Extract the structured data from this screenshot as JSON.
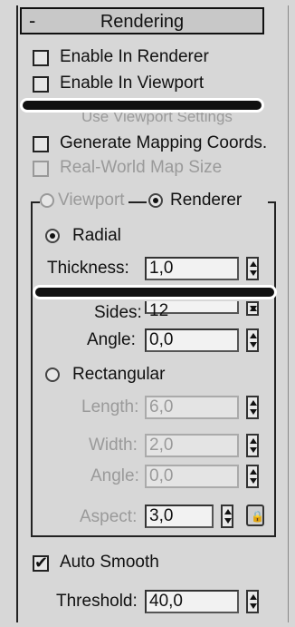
{
  "rollout": {
    "toggle": "-",
    "title": "Rendering"
  },
  "options": {
    "enable_in_renderer": "Enable In Renderer",
    "enable_in_viewport": "Enable In Viewport",
    "use_viewport_settings": "Use Viewport Settings",
    "generate_mapping_coords": "Generate Mapping Coords.",
    "real_world_map_size": "Real-World Map Size"
  },
  "mode": {
    "viewport": "Viewport",
    "renderer": "Renderer",
    "selected": "Renderer"
  },
  "radial": {
    "label": "Radial",
    "thickness_label": "Thickness:",
    "thickness_value": "1,0",
    "sides_label": "Sides:",
    "sides_value": "12",
    "angle_label": "Angle:",
    "angle_value": "0,0"
  },
  "rectangular": {
    "label": "Rectangular",
    "length_label": "Length:",
    "length_value": "6,0",
    "width_label": "Width:",
    "width_value": "2,0",
    "angle_label": "Angle:",
    "angle_value": "0,0",
    "aspect_label": "Aspect:",
    "aspect_value": "3,0"
  },
  "smoothing": {
    "auto_smooth_label": "Auto Smooth",
    "threshold_label": "Threshold:",
    "threshold_value": "40,0"
  },
  "icons": {
    "lock": "lock-icon"
  }
}
